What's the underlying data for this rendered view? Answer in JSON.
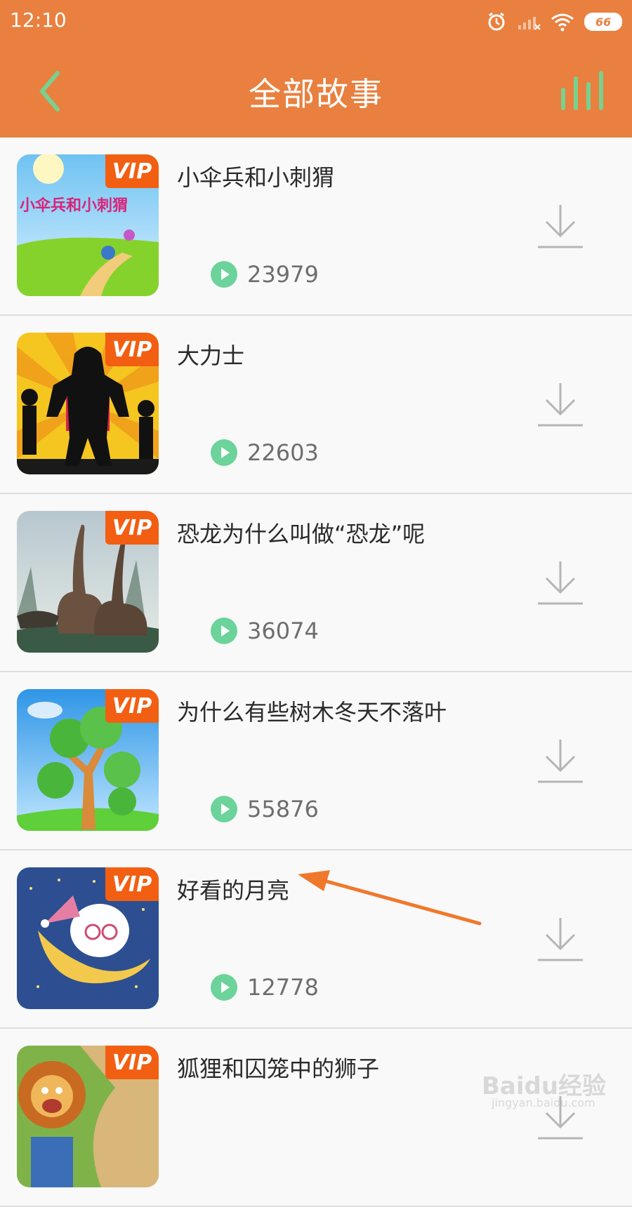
{
  "status_bar": {
    "time": "12:10",
    "battery": "66"
  },
  "header": {
    "title": "全部故事"
  },
  "badge_label": "VIP",
  "items": [
    {
      "title": "小伞兵和小刺猬",
      "play_count": "23979",
      "thumbnail_icon": "parachute-kids-illustration"
    },
    {
      "title": "大力士",
      "play_count": "22603",
      "thumbnail_icon": "strongman-silhouette-illustration"
    },
    {
      "title": "恐龙为什么叫做“恐龙”呢",
      "play_count": "36074",
      "thumbnail_icon": "dinosaurs-illustration"
    },
    {
      "title": "为什么有些树木冬天不落叶",
      "play_count": "55876",
      "thumbnail_icon": "tree-illustration"
    },
    {
      "title": "好看的月亮",
      "play_count": "12778",
      "thumbnail_icon": "moon-bear-illustration"
    },
    {
      "title": "狐狸和囚笼中的狮子",
      "play_count": "",
      "thumbnail_icon": "lion-illustration"
    }
  ],
  "watermark": {
    "main": "Baidu经验",
    "sub": "jingyan.baidu.com"
  },
  "colors": {
    "accent": "#e9803f",
    "badge": "#f25f12",
    "play": "#6cd39a",
    "back": "#79d18f"
  }
}
